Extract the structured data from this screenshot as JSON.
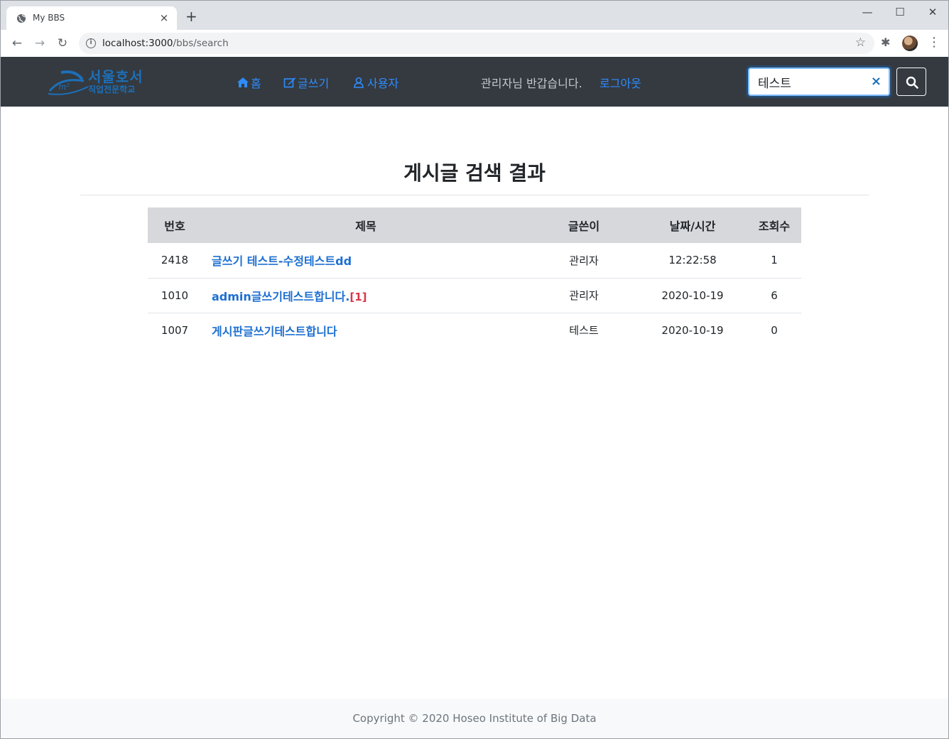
{
  "browser": {
    "tab_title": "My BBS",
    "tab_close": "×",
    "new_tab": "+",
    "url_host": "localhost:3000",
    "url_path": "/bbs/search",
    "win_min": "—",
    "win_max": "☐",
    "win_close": "✕"
  },
  "navbar": {
    "logo_line1": "서울호서",
    "logo_line2": "직업전문학교",
    "home": "홈",
    "write": "글쓰기",
    "users": "사용자",
    "greeting": "관리자님 반갑습니다.",
    "logout": "로그아웃",
    "search_value": "테스트",
    "search_clear": "×",
    "accent_color": "#2f8cff"
  },
  "main": {
    "title": "게시글 검색 결과",
    "columns": [
      "번호",
      "제목",
      "글쓴이",
      "날짜/시간",
      "조회수"
    ],
    "rows": [
      {
        "no": "2418",
        "subject": "글쓰기 테스트-수정테스트dd",
        "comments": "",
        "author": "관리자",
        "date": "12:22:58",
        "views": "1"
      },
      {
        "no": "1010",
        "subject": "admin글쓰기테스트합니다.",
        "comments": "[1]",
        "author": "관리자",
        "date": "2020-10-19",
        "views": "6"
      },
      {
        "no": "1007",
        "subject": "게시판글쓰기테스트합니다",
        "comments": "",
        "author": "테스트",
        "date": "2020-10-19",
        "views": "0"
      }
    ]
  },
  "footer": {
    "copyright": "Copyright © 2020 Hoseo Institute of Big Data"
  }
}
